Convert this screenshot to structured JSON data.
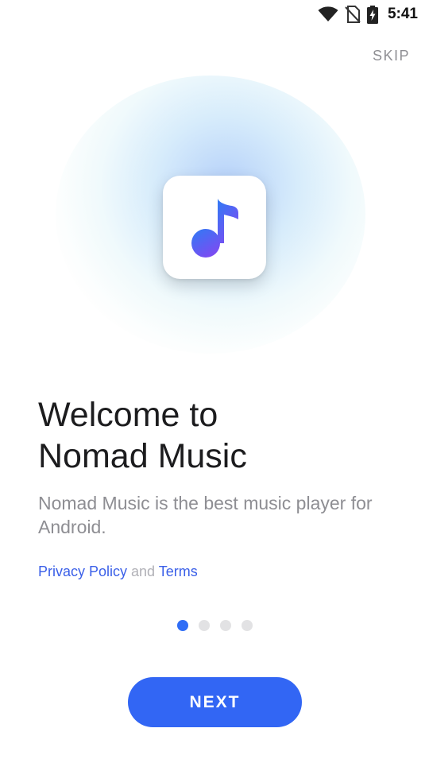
{
  "status_bar": {
    "time": "5:41",
    "icons": [
      "wifi-icon",
      "no-sim-icon",
      "battery-charging-icon"
    ]
  },
  "onboarding": {
    "skip_label": "SKIP",
    "app_icon": "music-note-icon",
    "title_line1": "Welcome to",
    "title_line2": "Nomad Music",
    "description": "Nomad Music is the best music player for Android.",
    "privacy_label": "Privacy Policy",
    "and_label": " and ",
    "terms_label": "Terms",
    "pages_total": 4,
    "page_current": 1,
    "next_label": "NEXT"
  },
  "colors": {
    "accent": "#3266f4",
    "note_gradient_start": "#2f7bf5",
    "note_gradient_end": "#7b4cf2",
    "muted_text": "#8e8e93"
  }
}
